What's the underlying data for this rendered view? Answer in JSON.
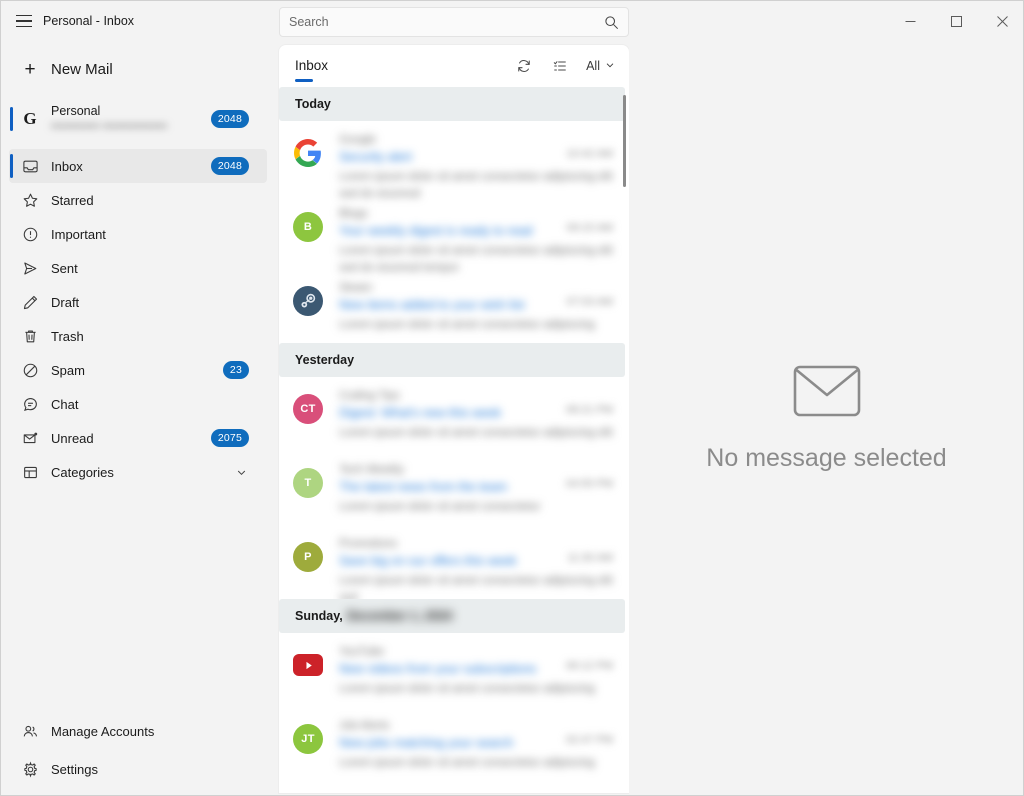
{
  "window": {
    "title": "Personal - Inbox",
    "menu_icon": "hamburger-icon",
    "minimize_label": "Minimize",
    "maximize_label": "Maximize",
    "close_label": "Close"
  },
  "search": {
    "placeholder": "Search",
    "value": "",
    "icon": "search-icon"
  },
  "sidebar": {
    "new_mail_label": "New Mail",
    "new_mail_icon": "plus-icon",
    "account": {
      "name": "Personal",
      "email": "•••••••••••• ••••••••••••••••",
      "provider_icon": "google-g-icon",
      "badge": "2048",
      "selected": true
    },
    "items": [
      {
        "label": "Inbox",
        "icon": "inbox-icon",
        "badge": "2048",
        "active": true
      },
      {
        "label": "Starred",
        "icon": "star-icon",
        "badge": "",
        "active": false
      },
      {
        "label": "Important",
        "icon": "exclamation-circle-icon",
        "badge": "",
        "active": false
      },
      {
        "label": "Sent",
        "icon": "send-icon",
        "badge": "",
        "active": false
      },
      {
        "label": "Draft",
        "icon": "pencil-icon",
        "badge": "",
        "active": false
      },
      {
        "label": "Trash",
        "icon": "trash-icon",
        "badge": "",
        "active": false
      },
      {
        "label": "Spam",
        "icon": "block-icon",
        "badge": "23",
        "active": false
      },
      {
        "label": "Chat",
        "icon": "chat-icon",
        "badge": "",
        "active": false
      },
      {
        "label": "Unread",
        "icon": "unread-mail-icon",
        "badge": "2075",
        "active": false
      },
      {
        "label": "Categories",
        "icon": "grid-icon",
        "badge": "",
        "active": false,
        "expandable": true
      }
    ],
    "bottom_items": [
      {
        "label": "Manage Accounts",
        "icon": "people-icon"
      },
      {
        "label": "Settings",
        "icon": "gear-icon"
      }
    ]
  },
  "list": {
    "tab_label": "Inbox",
    "refresh_icon": "sync-icon",
    "view_icon": "list-view-icon",
    "filter_label": "All",
    "filter_chevron_icon": "chevron-down-icon",
    "groups": [
      {
        "header": "Today",
        "header_blurred": "",
        "messages": [
          {
            "avatar_type": "google",
            "avatar_text": "",
            "avatar_color": "#ffffff",
            "sender": "Google",
            "subject": "Security alert",
            "preview": "Lorem ipsum dolor sit amet consectetur adipiscing elit sed do eiusmod",
            "time": "10:42 AM"
          },
          {
            "avatar_type": "letter",
            "avatar_text": "B",
            "avatar_color": "#8dc63f",
            "sender": "Blogs",
            "subject": "Your weekly digest is ready to read",
            "preview": "Lorem ipsum dolor sit amet consectetur adipiscing elit sed do eiusmod tempor",
            "time": "09:15 AM"
          },
          {
            "avatar_type": "steam",
            "avatar_text": "",
            "avatar_color": "#3b5872",
            "sender": "Steam",
            "subject": "New items added to your wish list",
            "preview": "Lorem ipsum dolor sit amet consectetur adipiscing",
            "time": "07:03 AM"
          }
        ]
      },
      {
        "header": "Yesterday",
        "header_blurred": "",
        "messages": [
          {
            "avatar_type": "letter",
            "avatar_text": "CT",
            "avatar_color": "#d94f7a",
            "sender": "Coding Tips",
            "subject": "Digest: What's new this week",
            "preview": "Lorem ipsum dolor sit amet consectetur adipiscing elit",
            "time": "08:21 PM"
          },
          {
            "avatar_type": "letter",
            "avatar_text": "T",
            "avatar_color": "#aed581",
            "sender": "Tech Weekly",
            "subject": "The latest news from the team",
            "preview": "Lorem ipsum dolor sit amet consectetur",
            "time": "04:55 PM"
          },
          {
            "avatar_type": "letter",
            "avatar_text": "P",
            "avatar_color": "#9eab3c",
            "sender": "Promotions",
            "subject": "Save big on our offers this week",
            "preview": "Lorem ipsum dolor sit amet consectetur adipiscing elit sed",
            "time": "11:30 AM"
          }
        ]
      },
      {
        "header": "Sunday,",
        "header_blurred": "December 1, 2024",
        "messages": [
          {
            "avatar_type": "youtube",
            "avatar_text": "",
            "avatar_color": "#cc2229",
            "sender": "YouTube",
            "subject": "New videos from your subscriptions",
            "preview": "Lorem ipsum dolor sit amet consectetur adipiscing",
            "time": "06:12 PM"
          },
          {
            "avatar_type": "letter",
            "avatar_text": "JT",
            "avatar_color": "#8cc63e",
            "sender": "Job Alerts",
            "subject": "New jobs matching your search",
            "preview": "Lorem ipsum dolor sit amet consectetur adipiscing",
            "time": "02:47 PM"
          }
        ]
      }
    ]
  },
  "reading_pane": {
    "empty_icon": "envelope-icon",
    "empty_text": "No message selected"
  },
  "colors": {
    "accent": "#0f6cbd",
    "selection_bar": "#0f5fc2",
    "window_bg": "#f3f3f3",
    "list_bg": "#ffffff",
    "group_header_bg": "#e9edee",
    "subject_unread": "#1f78d8"
  }
}
